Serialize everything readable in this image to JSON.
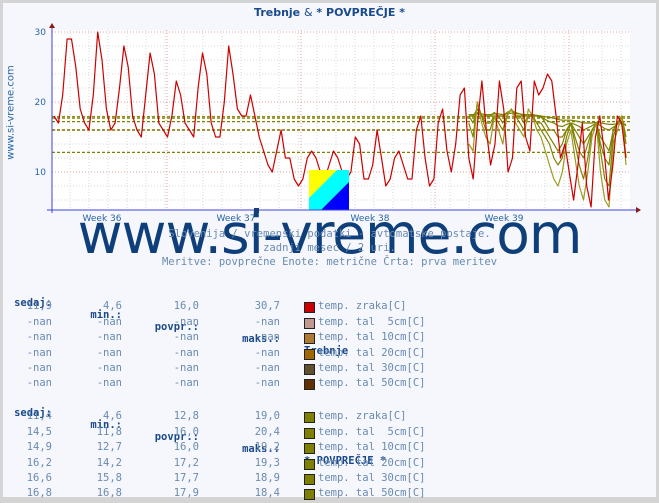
{
  "title": {
    "part1": "Trebnje",
    "amp": "&",
    "part2": "* POVPREČJE *"
  },
  "side_label": "www.si-vreme.com",
  "watermark": "www.si-vreme.com",
  "subtitles": [
    "Slovenija / vremenski podatki - avtomatske postaje.",
    "zadnji mesec / 2 uri.",
    "Meritve: povprečne  Enote: metrične  Črta: prva meritev"
  ],
  "chart_data": {
    "type": "line",
    "title": "Trebnje & * POVPREČJE *",
    "xlabel": "",
    "ylabel": "",
    "ylim": [
      5,
      30
    ],
    "yticks": [
      10,
      20,
      30
    ],
    "xticks": [
      "Week 36",
      "Week 37",
      "Week 38",
      "Week 39"
    ],
    "grid": true,
    "colors": {
      "air": "#cc0000",
      "avg": "#808000"
    },
    "reference_lines": [
      {
        "name": "Trebnje air avg",
        "value": 16.0,
        "color": "#cc0000"
      },
      {
        "name": "avg air",
        "value": 12.8,
        "color": "#808000"
      },
      {
        "name": "avg 5cm",
        "value": 16.0,
        "color": "#808000"
      },
      {
        "name": "avg 10cm",
        "value": 16.0,
        "color": "#808000"
      },
      {
        "name": "avg 20cm",
        "value": 17.2,
        "color": "#808000"
      },
      {
        "name": "avg 30cm",
        "value": 17.7,
        "color": "#808000"
      },
      {
        "name": "avg 50cm",
        "value": 17.9,
        "color": "#808000"
      }
    ],
    "series": [
      {
        "name": "Trebnje temp. zraka[C]",
        "color": "#cc0000",
        "values": [
          18,
          17,
          21,
          29,
          29,
          25,
          19,
          17,
          16,
          21,
          30,
          26,
          19,
          16,
          17,
          22,
          28,
          25,
          18,
          16,
          15,
          21,
          27,
          24,
          17,
          16,
          15,
          18,
          23,
          21,
          17,
          16,
          15,
          22,
          27,
          24,
          17,
          15,
          15,
          20,
          28,
          24,
          19,
          18,
          18,
          21,
          18,
          15,
          13,
          11,
          10,
          13,
          16,
          12,
          12,
          9,
          8,
          9,
          12,
          13,
          12,
          10,
          9,
          11,
          13,
          12,
          10,
          9,
          10,
          15,
          14,
          9,
          9,
          11,
          16,
          12,
          8,
          9,
          12,
          13,
          11,
          9,
          9,
          16,
          18,
          12,
          8,
          9,
          17,
          19,
          13,
          10,
          14,
          21,
          22,
          12,
          9,
          17,
          23,
          16,
          11,
          14,
          23,
          19,
          10,
          12,
          22,
          23,
          15,
          13,
          23,
          21,
          22,
          24,
          23,
          18,
          12,
          14,
          10,
          6,
          11,
          17,
          8,
          5,
          15,
          18,
          13,
          6,
          11,
          18,
          17,
          12
        ]
      },
      {
        "name": "* POVPREČJE * temp. zraka[C]",
        "color": "#9a9a20",
        "start_index": 95,
        "values": [
          14,
          13,
          20,
          17,
          15,
          14,
          18,
          16,
          14,
          18,
          19,
          17,
          16,
          15,
          19,
          18,
          16,
          15,
          13,
          11,
          9,
          8,
          10,
          14,
          16,
          12,
          8,
          6,
          10,
          15,
          17,
          10,
          6,
          5,
          14,
          16,
          18,
          11
        ]
      },
      {
        "name": "* POVPREČJE * temp. tal 5cm[C]",
        "color": "#808000",
        "start_index": 95,
        "values": [
          17,
          15,
          20,
          18,
          16,
          16,
          18,
          17,
          16,
          18,
          19,
          18,
          17,
          16,
          18,
          18,
          17,
          16,
          15,
          14,
          12,
          11,
          12,
          15,
          17,
          14,
          11,
          9,
          12,
          16,
          17,
          13,
          9,
          8,
          15,
          17,
          18,
          12
        ]
      },
      {
        "name": "* POVPREČJE * temp. tal 10cm[C]",
        "color": "#808000",
        "start_index": 95,
        "values": [
          18,
          17,
          19,
          18,
          17,
          17,
          18,
          18,
          17,
          18,
          19,
          18,
          18,
          17,
          18,
          18,
          17,
          17,
          16,
          15,
          14,
          13,
          14,
          16,
          17,
          15,
          13,
          12,
          14,
          16,
          17,
          14,
          12,
          11,
          16,
          17,
          18,
          14
        ]
      },
      {
        "name": "* POVPREČJE * temp. tal 20cm[C]",
        "color": "#808000",
        "start_index": 95,
        "values": [
          18,
          18,
          19,
          18,
          18,
          18,
          18,
          18,
          18,
          18,
          19,
          18,
          18,
          18,
          18,
          18,
          18,
          18,
          17,
          16,
          16,
          15,
          15,
          16,
          17,
          16,
          15,
          14,
          15,
          16,
          17,
          15,
          14,
          13,
          16,
          17,
          18,
          15
        ]
      },
      {
        "name": "* POVPREČJE * temp. tal 30cm[C]",
        "color": "#808000",
        "start_index": 95,
        "values": [
          18,
          18,
          18.5,
          18,
          18,
          18,
          18.5,
          18,
          18,
          18.5,
          18.8,
          18.5,
          18.3,
          18,
          18.2,
          18.2,
          18,
          17.8,
          17.5,
          17.2,
          17,
          16.6,
          16.5,
          16.8,
          17,
          16.8,
          16.5,
          16,
          16.3,
          16.6,
          17,
          16.6,
          16.2,
          16,
          16.4,
          16.8,
          17.2,
          16.6
        ]
      },
      {
        "name": "* POVPREČJE * temp. tal 50cm[C]",
        "color": "#808000",
        "start_index": 95,
        "values": [
          18.2,
          18.2,
          18.3,
          18.3,
          18.2,
          18.2,
          18.3,
          18.3,
          18.2,
          18.3,
          18.4,
          18.3,
          18.3,
          18.2,
          18.2,
          18.2,
          18.1,
          18,
          17.9,
          17.8,
          17.7,
          17.5,
          17.4,
          17.4,
          17.4,
          17.3,
          17.2,
          17,
          17,
          17,
          17.1,
          17,
          16.9,
          16.8,
          16.8,
          16.9,
          16.9,
          16.8
        ]
      }
    ]
  },
  "tables": [
    {
      "headers": [
        "sedaj:",
        "min.:",
        "povpr.:",
        "maks.:"
      ],
      "station": "Trebnje",
      "rows": [
        {
          "sedaj": "11,9",
          "min": "4,6",
          "povpr": "16,0",
          "maks": "30,7",
          "label": "temp. zraka[C]",
          "color": "#cc0000"
        },
        {
          "sedaj": "-nan",
          "min": "-nan",
          "povpr": "-nan",
          "maks": "-nan",
          "label": "temp. tal  5cm[C]",
          "color": "#c09890"
        },
        {
          "sedaj": "-nan",
          "min": "-nan",
          "povpr": "-nan",
          "maks": "-nan",
          "label": "temp. tal 10cm[C]",
          "color": "#b07830"
        },
        {
          "sedaj": "-nan",
          "min": "-nan",
          "povpr": "-nan",
          "maks": "-nan",
          "label": "temp. tal 20cm[C]",
          "color": "#a06800"
        },
        {
          "sedaj": "-nan",
          "min": "-nan",
          "povpr": "-nan",
          "maks": "-nan",
          "label": "temp. tal 30cm[C]",
          "color": "#605030"
        },
        {
          "sedaj": "-nan",
          "min": "-nan",
          "povpr": "-nan",
          "maks": "-nan",
          "label": "temp. tal 50cm[C]",
          "color": "#603000"
        }
      ]
    },
    {
      "headers": [
        "sedaj:",
        "min.:",
        "povpr.:",
        "maks.:"
      ],
      "station": "* POVPREČJE *",
      "rows": [
        {
          "sedaj": "11,4",
          "min": "4,6",
          "povpr": "12,8",
          "maks": "19,0",
          "label": "temp. zraka[C]",
          "color": "#808000"
        },
        {
          "sedaj": "14,5",
          "min": "11,8",
          "povpr": "16,0",
          "maks": "20,4",
          "label": "temp. tal  5cm[C]",
          "color": "#808000"
        },
        {
          "sedaj": "14,9",
          "min": "12,7",
          "povpr": "16,0",
          "maks": "19,2",
          "label": "temp. tal 10cm[C]",
          "color": "#808000"
        },
        {
          "sedaj": "16,2",
          "min": "14,2",
          "povpr": "17,2",
          "maks": "19,3",
          "label": "temp. tal 20cm[C]",
          "color": "#808000"
        },
        {
          "sedaj": "16,6",
          "min": "15,8",
          "povpr": "17,7",
          "maks": "18,9",
          "label": "temp. tal 30cm[C]",
          "color": "#808000"
        },
        {
          "sedaj": "16,8",
          "min": "16,8",
          "povpr": "17,9",
          "maks": "18,4",
          "label": "temp. tal 50cm[C]",
          "color": "#808000"
        }
      ]
    }
  ]
}
